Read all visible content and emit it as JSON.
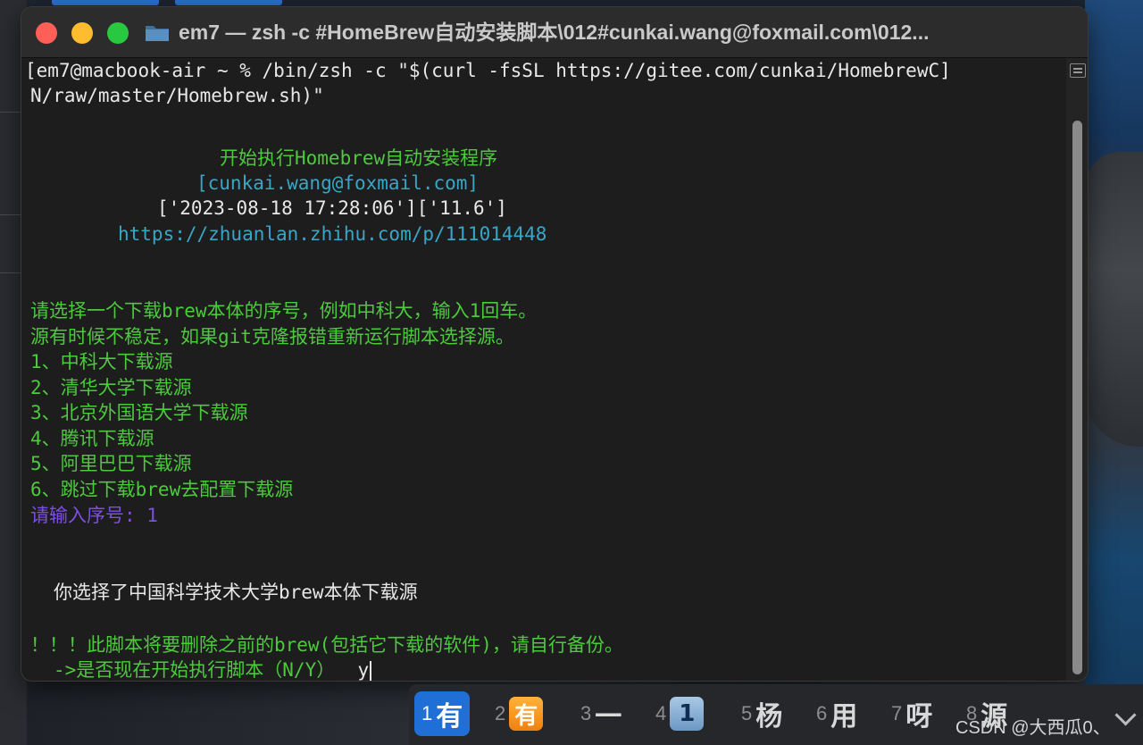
{
  "window": {
    "title": "em7 — zsh -c #HomeBrew自动安装脚本\\012#cunkai.wang@foxmail.com\\012..."
  },
  "terminal": {
    "prompt_line": "em7@macbook-air ~ % /bin/zsh -c \"$(curl -fsSL https://gitee.com/cunkai/HomebrewC",
    "prompt_line_cont": "N/raw/master/Homebrew.sh)\"",
    "banner_title": "开始执行Homebrew自动安装程序",
    "banner_email": "[cunkai.wang@foxmail.com]",
    "banner_time": "['2023-08-18 17:28:06']['11.6']",
    "banner_url": "https://zhuanlan.zhihu.com/p/111014448",
    "choose_prompt": "请选择一个下载brew本体的序号，例如中科大，输入1回车。",
    "unstable_note": "源有时候不稳定，如果git克隆报错重新运行脚本选择源。",
    "options": [
      "1、中科大下载源",
      "2、清华大学下载源",
      "3、北京外国语大学下载源",
      "4、腾讯下载源",
      "5、阿里巴巴下载源",
      "6、跳过下载brew去配置下载源"
    ],
    "input_prompt": "请输入序号: 1",
    "selected_msg": "你选择了中国科学技术大学brew本体下载源",
    "warning": "！！！此脚本将要删除之前的brew(包括它下载的软件)，请自行备份。",
    "confirm_prompt": "->是否现在开始执行脚本（N/Y）",
    "confirm_input": "y"
  },
  "ime": {
    "candidates": [
      {
        "num": "1",
        "text": "有"
      },
      {
        "num": "2",
        "text": "有"
      },
      {
        "num": "3",
        "text": "一"
      },
      {
        "num": "4",
        "text": "1"
      },
      {
        "num": "5",
        "text": "杨"
      },
      {
        "num": "6",
        "text": "用"
      },
      {
        "num": "7",
        "text": "呀"
      },
      {
        "num": "8",
        "text": "源"
      }
    ]
  },
  "watermark": "CSDN @大西瓜0、",
  "colors": {
    "green": "#4cc93d",
    "cyan": "#39a6c7",
    "purple": "#7c4fe0",
    "ime_selected": "#1f6fd6"
  }
}
